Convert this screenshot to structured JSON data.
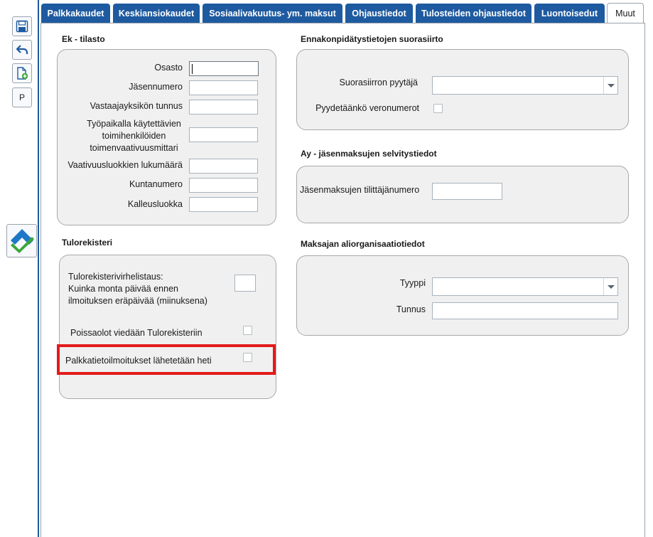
{
  "toolbar": {
    "items": [
      {
        "icon": "save-icon"
      },
      {
        "icon": "undo-icon"
      },
      {
        "icon": "new-document-icon"
      },
      {
        "label": "P"
      }
    ],
    "logo_icon": "app-logo-icon"
  },
  "tabs": [
    {
      "label": "Palkkakaudet"
    },
    {
      "label": "Keskiansiokaudet"
    },
    {
      "label": "Sosiaalivakuutus- ym. maksut"
    },
    {
      "label": "Ohjaustiedot"
    },
    {
      "label": "Tulosteiden ohjaustiedot"
    },
    {
      "label": "Luontoisedut"
    },
    {
      "label": "Muut",
      "active": true
    }
  ],
  "ek_tilasto": {
    "title": "Ek - tilasto",
    "fields": [
      {
        "label": "Osasto",
        "value": ""
      },
      {
        "label": "Jäsennumero",
        "value": ""
      },
      {
        "label": "Vastaajayksikön tunnus",
        "value": ""
      },
      {
        "label_lines": [
          "Työpaikalla käytettävien",
          "toimihenkilöiden",
          "toimenvaativuusmittari"
        ],
        "value": ""
      },
      {
        "label": "Vaativuusluokkien lukumäärä",
        "value": ""
      },
      {
        "label": "Kuntanumero",
        "value": ""
      },
      {
        "label": "Kalleusluokka",
        "value": ""
      }
    ]
  },
  "tulorekisteri": {
    "title": "Tulorekisteri",
    "error_days_label_lines": [
      "Tulorekisterivirhelistaus:",
      "Kuinka monta päivää ennen",
      "ilmoituksen eräpäivää (miinuksena)"
    ],
    "error_days_value": "",
    "absences_label": "Poissaolot viedään Tulorekisteriin",
    "absences_checked": false,
    "salary_immediate_label": "Palkkatietoilmoitukset lähetetään heti",
    "salary_immediate_checked": false,
    "highlight_color": "#e31a1a"
  },
  "ennakonpidatys": {
    "title": "Ennakonpidätystietojen suorasiirto",
    "requester_label": "Suorasiirron pyytäjä",
    "requester_value": "",
    "tax_numbers_label": "Pyydetäänkö veronumerot",
    "tax_numbers_checked": false
  },
  "ay": {
    "title": "Ay - jäsenmaksujen selvitystiedot",
    "payer_number_label": "Jäsenmaksujen tilittäjänumero",
    "payer_number_value": ""
  },
  "maksajan": {
    "title": "Maksajan aliorganisaatiotiedot",
    "type_label": "Tyyppi",
    "type_value": "",
    "code_label": "Tunnus",
    "code_value": ""
  },
  "colors": {
    "accent": "#1e5aa0",
    "panel_bg": "#f0f0f0",
    "border": "#a9a9a9"
  }
}
